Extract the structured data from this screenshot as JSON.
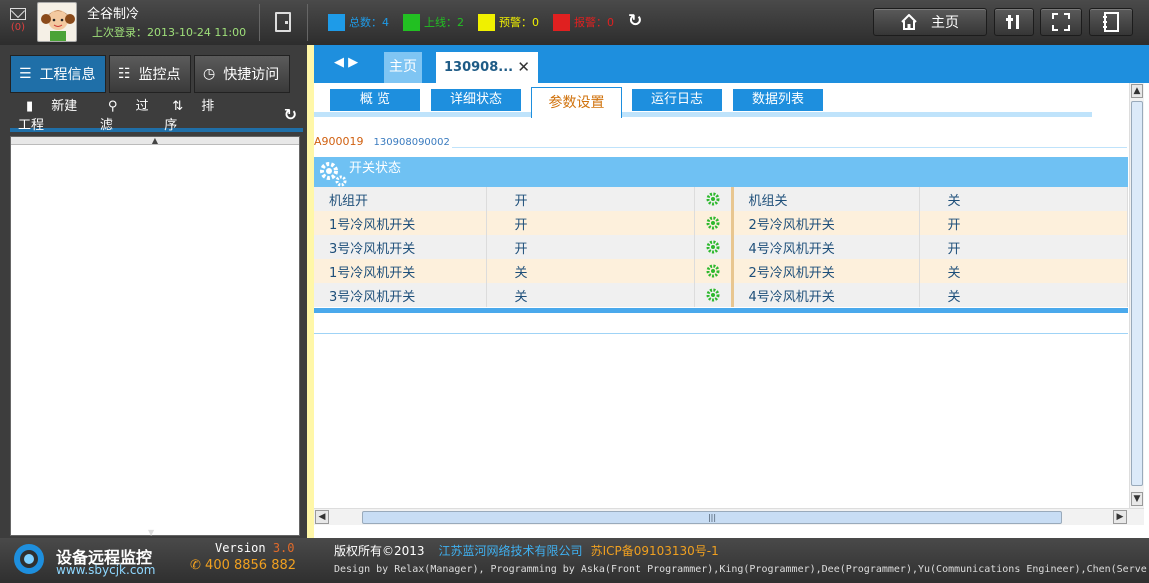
{
  "header": {
    "mail_count": "(0)",
    "user_name": "全谷制冷",
    "last_login": "上次登录：2013-10-24 11:00",
    "stats": [
      {
        "label": "总数：4",
        "color": "#1e9be8",
        "text_color": "#1e9be8"
      },
      {
        "label": "上线：2",
        "color": "#22c022",
        "text_color": "#22c022"
      },
      {
        "label": "预警：0",
        "color": "#f0f000",
        "text_color": "#f0f000"
      },
      {
        "label": "报警：0",
        "color": "#e02020",
        "text_color": "#e02020"
      }
    ],
    "home_label": "主页"
  },
  "sidebar": {
    "tabs": [
      "工程信息",
      "监控点",
      "快捷访问"
    ],
    "toolbar": {
      "new": "新建工程",
      "filter": "过滤",
      "sort": "排序"
    }
  },
  "main": {
    "tabs": {
      "home": "主页",
      "project": "130908..."
    },
    "subtabs": [
      "概 览",
      "详细状态",
      "参数设置",
      "运行日志",
      "数据列表"
    ],
    "active_subtab": "参数设置",
    "device_code": "A900019",
    "device_id": "130908090002",
    "panel_title": "开关状态",
    "rows": [
      {
        "left_name": "机组开",
        "left_value": "开",
        "right_name": "机组关",
        "right_value": "关"
      },
      {
        "left_name": "1号冷风机开关",
        "left_value": "开",
        "right_name": "2号冷风机开关",
        "right_value": "开"
      },
      {
        "left_name": "3号冷风机开关",
        "left_value": "开",
        "right_name": "4号冷风机开关",
        "right_value": "开"
      },
      {
        "left_name": "1号冷风机开关",
        "left_value": "关",
        "right_name": "2号冷风机开关",
        "right_value": "关"
      },
      {
        "left_name": "3号冷风机开关",
        "left_value": "关",
        "right_name": "4号冷风机开关",
        "right_value": "关"
      }
    ]
  },
  "footer": {
    "logo_title": "设备远程监控",
    "logo_url": "www.sbycjk.com",
    "version_label": "Version",
    "version_number": "3.0",
    "phone": "400 8856 882",
    "copyright": "版权所有©2013",
    "company": "江苏蓝河网络技术有限公司",
    "icp": "苏ICP备09103130号-1",
    "design_credits": "Design by Relax(Manager), Programming by Aska(Front Programmer),King(Programmer),Dee(Programmer),Yu(Communications Engineer),Chen(Serve"
  }
}
